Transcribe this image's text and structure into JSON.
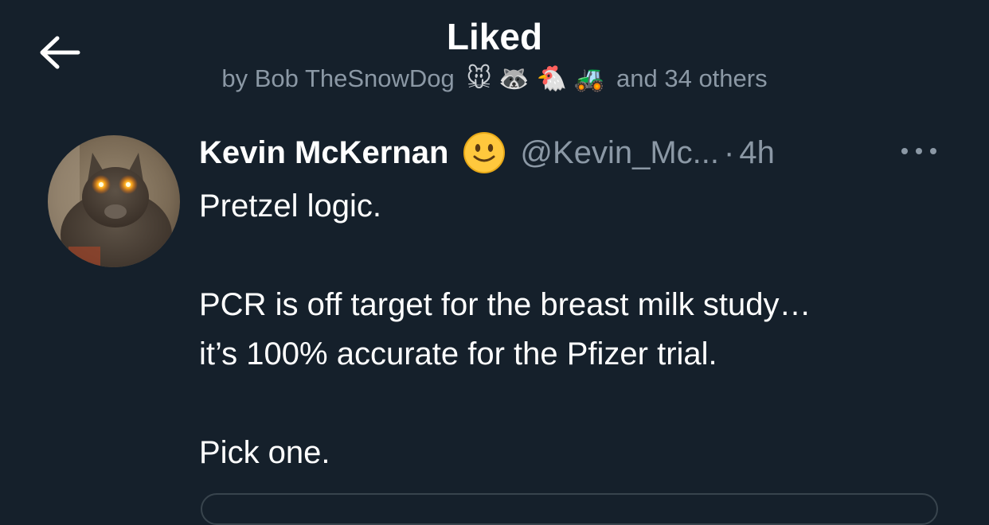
{
  "header": {
    "back_icon": "arrow-left-icon",
    "title": "Liked",
    "subtitle_prefix": "by Bob TheSnowDog",
    "subtitle_emojis": "🐭 🦝 🐔 🚜",
    "subtitle_suffix": "and 34 others"
  },
  "tweet": {
    "author_name": "Kevin McKernan",
    "author_emoji": "🙂",
    "author_handle": "@Kevin_Mc...",
    "separator": "·",
    "timestamp": "4h",
    "more_icon": "more-horizontal-icon",
    "body": {
      "line1": "Pretzel logic.",
      "line2": "PCR is off target for the breast milk study…\nit’s 100% accurate for the Pfizer trial.",
      "line3": "Pick one."
    }
  },
  "colors": {
    "background": "#15202b",
    "primary_text": "#ffffff",
    "secondary_text": "#8b98a5",
    "border": "#38444d"
  }
}
